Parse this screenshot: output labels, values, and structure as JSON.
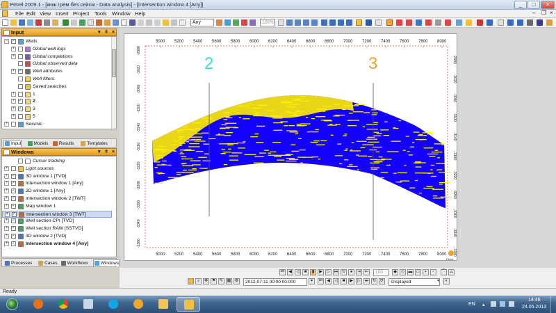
{
  "window": {
    "title": "Petrel 2009.1 - [кюж грем без сейсм - Data analysis] - [Intersection window 4 [Any]]",
    "controls": [
      "_",
      "□",
      "×"
    ]
  },
  "menu": {
    "file": "File",
    "edit": "Edit",
    "view": "View",
    "insert": "Insert",
    "project": "Project",
    "tools": "Tools",
    "window": "Window",
    "help": "Help"
  },
  "toolbar": {
    "domain_combo": "Any",
    "zoom_value": "100%"
  },
  "input_panel": {
    "title": "Input",
    "tree": [
      {
        "label": "Wells",
        "style": "normal",
        "indent": 0,
        "expander": "-",
        "checked": true,
        "icon_color": "#5aa0d8"
      },
      {
        "label": "Global well logs",
        "style": "it",
        "indent": 1,
        "expander": "+",
        "checked": false,
        "icon_color": "#b07ad0"
      },
      {
        "label": "Global completions",
        "style": "it",
        "indent": 1,
        "expander": "+",
        "checked": false,
        "icon_color": "#7a5ab8"
      },
      {
        "label": "Global observed data",
        "style": "it",
        "indent": 1,
        "expander": "",
        "checked": false,
        "icon_color": "#d04848"
      },
      {
        "label": "Well attributes",
        "style": "it",
        "indent": 1,
        "expander": "+",
        "checked": true,
        "icon_color": "#6a6a6a"
      },
      {
        "label": "Well filters",
        "style": "it",
        "indent": 1,
        "expander": "",
        "checked": false,
        "icon_color": "#f0d040"
      },
      {
        "label": "Saved searches",
        "style": "it",
        "indent": 1,
        "expander": "",
        "checked": false,
        "icon_color": "#f0c040"
      },
      {
        "label": "1",
        "style": "normal",
        "indent": 1,
        "expander": "+",
        "checked": false,
        "icon_color": "#f0d878"
      },
      {
        "label": "2",
        "style": "b",
        "indent": 1,
        "expander": "+",
        "checked": true,
        "icon_color": "#f0d878"
      },
      {
        "label": "3",
        "style": "normal",
        "indent": 1,
        "expander": "+",
        "checked": true,
        "icon_color": "#f0d878"
      },
      {
        "label": "5",
        "style": "normal",
        "indent": 1,
        "expander": "+",
        "checked": false,
        "icon_color": "#f0d878"
      },
      {
        "label": "Seismic",
        "style": "normal",
        "indent": 0,
        "expander": "+",
        "checked": false,
        "icon_color": "#5aa0d8"
      }
    ],
    "tabs": [
      "Input",
      "Models",
      "Results",
      "Templates"
    ]
  },
  "windows_panel": {
    "title": "Windows",
    "tree": [
      {
        "label": "Cursor tracking",
        "style": "it",
        "indent": 1,
        "expander": "",
        "checked": false,
        "icon_color": "#ffffff"
      },
      {
        "label": "Light sources",
        "style": "it",
        "indent": 0,
        "expander": "+",
        "checked": false,
        "icon_color": "#f0c040"
      },
      {
        "label": "3D window 1 [TVD]",
        "style": "normal",
        "indent": 0,
        "expander": "+",
        "checked": true,
        "icon_color": "#4a78c0"
      },
      {
        "label": "Intersection window 1 [Any]",
        "style": "normal",
        "indent": 0,
        "expander": "+",
        "checked": true,
        "icon_color": "#c06a38"
      },
      {
        "label": "2D window 1 [Any]",
        "style": "normal",
        "indent": 0,
        "expander": "+",
        "checked": true,
        "icon_color": "#4a78c0"
      },
      {
        "label": "Intersection window 2 [TWT]",
        "style": "normal",
        "indent": 0,
        "expander": "+",
        "checked": true,
        "icon_color": "#c06a38"
      },
      {
        "label": "Map window 1",
        "style": "normal",
        "indent": 0,
        "expander": "+",
        "checked": true,
        "icon_color": "#4aa060"
      },
      {
        "label": "Intersection window 3 [TWT]",
        "style": "normal",
        "indent": 0,
        "expander": "+",
        "checked": true,
        "icon_color": "#c06a38",
        "selected": true
      },
      {
        "label": "Well section CPI [TVD]",
        "style": "normal",
        "indent": 0,
        "expander": "+",
        "checked": true,
        "icon_color": "#4aa060"
      },
      {
        "label": "Well section RAW [SSTVD]",
        "style": "normal",
        "indent": 0,
        "expander": "+",
        "checked": true,
        "icon_color": "#4aa060"
      },
      {
        "label": "3D window 2 [TVD]",
        "style": "normal",
        "indent": 0,
        "expander": "+",
        "checked": true,
        "icon_color": "#4a78c0"
      },
      {
        "label": "Intersection window 4 [Any]",
        "style": "b",
        "indent": 0,
        "expander": "+",
        "checked": true,
        "icon_color": "#c06a38"
      }
    ],
    "tabs": [
      "Processes",
      "Cases",
      "Workflows",
      "Windows"
    ]
  },
  "section": {
    "x_ticks": [
      "5000",
      "5200",
      "5400",
      "5600",
      "5800",
      "6000",
      "6200",
      "6400",
      "6600",
      "6800",
      "7000",
      "7200",
      "7400",
      "7600",
      "7800",
      "8000"
    ],
    "y_ticks": [
      "-2980",
      "-3000",
      "-3020",
      "-3040",
      "-3060",
      "-3080",
      "-3100",
      "-3120",
      "-3140",
      "-3160",
      "-3180",
      "-3200",
      "-3220",
      "-3240",
      "-3260",
      "-3280",
      "-3300",
      "-3320",
      "-3340",
      "-3360",
      "-3380"
    ],
    "wells": [
      {
        "label": "2",
        "color": "#36e6c8"
      },
      {
        "label": "3",
        "color": "#f0a32a"
      }
    ],
    "colors": {
      "facies_a": "#1400ff",
      "facies_b": "#ffee00",
      "frame": "#d44"
    },
    "logo_text": "Petrel"
  },
  "playback": {
    "datetime": "2012-07-11 00:00:00.000",
    "mode": "Displayed",
    "step": "100"
  },
  "status": {
    "text": "Ready"
  },
  "taskbar": {
    "lang": "EN",
    "time": "14:46",
    "date": "24.05.2013"
  }
}
